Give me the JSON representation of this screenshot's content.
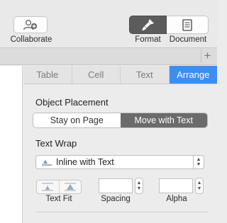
{
  "toolbar": {
    "collaborate_label": "Collaborate",
    "format_label": "Format",
    "document_label": "Document",
    "add_sheet_symbol": "+"
  },
  "inspector": {
    "tabs": [
      {
        "label": "Table",
        "active": false
      },
      {
        "label": "Cell",
        "active": false
      },
      {
        "label": "Text",
        "active": false
      },
      {
        "label": "Arrange",
        "active": true
      }
    ],
    "object_placement": {
      "title": "Object Placement",
      "options": [
        "Stay on Page",
        "Move with Text"
      ],
      "selected": "Move with Text"
    },
    "text_wrap": {
      "title": "Text Wrap",
      "selected_value": "Inline with Text"
    },
    "controls": {
      "text_fit_label": "Text Fit",
      "spacing_label": "Spacing",
      "spacing_value": "",
      "alpha_label": "Alpha",
      "alpha_value": ""
    }
  },
  "colors": {
    "accent": "#3c8ef0",
    "segment_selected": "#6b6b6b",
    "toolbar_selected": "#5c5c5c"
  }
}
